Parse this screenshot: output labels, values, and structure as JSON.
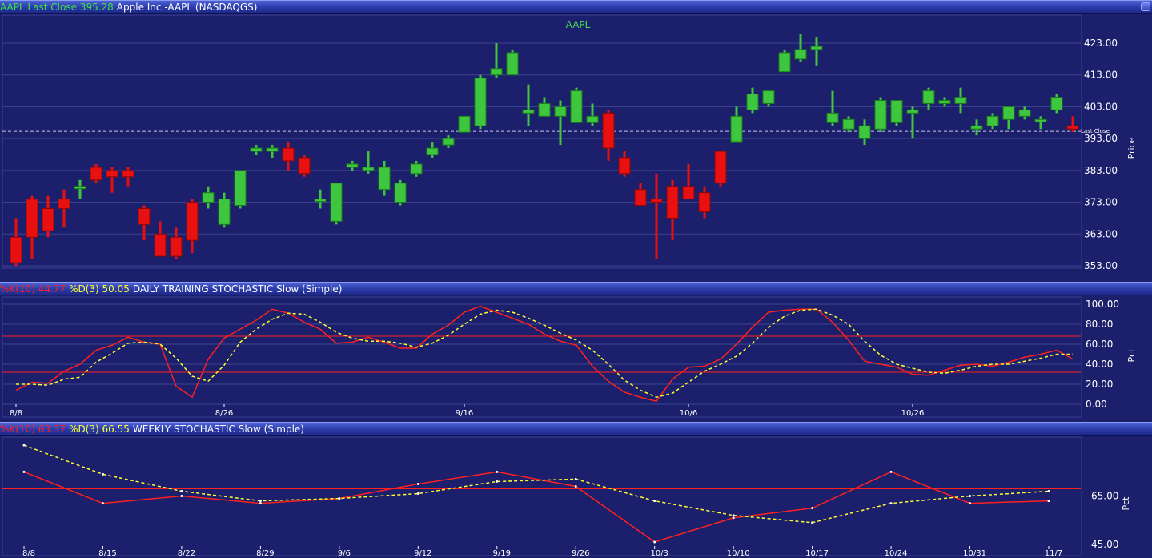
{
  "price_header": {
    "last_close_label": "AAPL.Last Close 395.28",
    "security": "Apple Inc.-AAPL (NASDAQGS)"
  },
  "daily_header": {
    "k_label": "%K(10) 44.77",
    "d_label": "%D(3) 50.05",
    "title": "DAILY TRAINING STOCHASTIC Slow (Simple)"
  },
  "weekly_header": {
    "k_label": "%K(10) 63.37",
    "d_label": "%D(3) 66.55",
    "title": "WEEKLY STOCHASTIC Slow (Simple)"
  },
  "colors": {
    "background": "#1c1f6b",
    "up": "#3ec63e",
    "down": "#e81010",
    "k_line": "#ff2020",
    "d_line": "#ffff30",
    "grid": "#3d4490"
  },
  "chart_data": [
    {
      "type": "candlestick",
      "title": "AAPL",
      "ylabel": "Price",
      "ylim": [
        353,
        423
      ],
      "yticks": [
        "423.00",
        "413.00",
        "403.00",
        "393.00",
        "383.00",
        "373.00",
        "363.00",
        "353.00"
      ],
      "last_close": 395.28,
      "last_close_label": "Last Close",
      "candles": [
        {
          "o": 362,
          "h": 368,
          "l": 353,
          "c": 354
        },
        {
          "o": 374,
          "h": 375,
          "l": 355,
          "c": 362
        },
        {
          "o": 371,
          "h": 375,
          "l": 362,
          "c": 364
        },
        {
          "o": 374,
          "h": 377,
          "l": 365,
          "c": 371
        },
        {
          "o": 378,
          "h": 380,
          "l": 374,
          "c": 378
        },
        {
          "o": 384,
          "h": 385,
          "l": 379,
          "c": 380
        },
        {
          "o": 383,
          "h": 384,
          "l": 376,
          "c": 381
        },
        {
          "o": 383,
          "h": 384,
          "l": 378,
          "c": 381
        },
        {
          "o": 371,
          "h": 372,
          "l": 361,
          "c": 366
        },
        {
          "o": 363,
          "h": 367,
          "l": 356,
          "c": 356
        },
        {
          "o": 362,
          "h": 365,
          "l": 355,
          "c": 356
        },
        {
          "o": 373,
          "h": 374,
          "l": 357,
          "c": 361
        },
        {
          "o": 373,
          "h": 378,
          "l": 371,
          "c": 376
        },
        {
          "o": 366,
          "h": 376,
          "l": 365,
          "c": 374
        },
        {
          "o": 372,
          "h": 383,
          "l": 371,
          "c": 383
        },
        {
          "o": 389,
          "h": 391,
          "l": 388,
          "c": 390
        },
        {
          "o": 389,
          "h": 391,
          "l": 387,
          "c": 390
        },
        {
          "o": 390,
          "h": 392,
          "l": 383,
          "c": 386
        },
        {
          "o": 387,
          "h": 388,
          "l": 381,
          "c": 382
        },
        {
          "o": 374,
          "h": 377,
          "l": 371,
          "c": 374
        },
        {
          "o": 367,
          "h": 379,
          "l": 366,
          "c": 379
        },
        {
          "o": 384,
          "h": 386,
          "l": 383,
          "c": 385
        },
        {
          "o": 383,
          "h": 389,
          "l": 382,
          "c": 384
        },
        {
          "o": 377,
          "h": 386,
          "l": 375,
          "c": 384
        },
        {
          "o": 373,
          "h": 380,
          "l": 372,
          "c": 379
        },
        {
          "o": 382,
          "h": 386,
          "l": 381,
          "c": 385
        },
        {
          "o": 388,
          "h": 392,
          "l": 387,
          "c": 390
        },
        {
          "o": 391,
          "h": 394,
          "l": 390,
          "c": 393
        },
        {
          "o": 395,
          "h": 400,
          "l": 395,
          "c": 400
        },
        {
          "o": 397,
          "h": 413,
          "l": 396,
          "c": 412
        },
        {
          "o": 413,
          "h": 423,
          "l": 412,
          "c": 415
        },
        {
          "o": 413,
          "h": 421,
          "l": 413,
          "c": 420
        },
        {
          "o": 401,
          "h": 410,
          "l": 397,
          "c": 402
        },
        {
          "o": 400,
          "h": 406,
          "l": 400,
          "c": 404
        },
        {
          "o": 400,
          "h": 405,
          "l": 391,
          "c": 403
        },
        {
          "o": 398,
          "h": 409,
          "l": 398,
          "c": 408
        },
        {
          "o": 398,
          "h": 404,
          "l": 397,
          "c": 400
        },
        {
          "o": 401,
          "h": 402,
          "l": 386,
          "c": 390
        },
        {
          "o": 387,
          "h": 389,
          "l": 381,
          "c": 382
        },
        {
          "o": 377,
          "h": 379,
          "l": 373,
          "c": 372
        },
        {
          "o": 374,
          "h": 382,
          "l": 355,
          "c": 373
        },
        {
          "o": 378,
          "h": 380,
          "l": 361,
          "c": 368
        },
        {
          "o": 378,
          "h": 385,
          "l": 374,
          "c": 374
        },
        {
          "o": 376,
          "h": 378,
          "l": 368,
          "c": 370
        },
        {
          "o": 389,
          "h": 389,
          "l": 378,
          "c": 379
        },
        {
          "o": 392,
          "h": 403,
          "l": 392,
          "c": 400
        },
        {
          "o": 402,
          "h": 409,
          "l": 401,
          "c": 407
        },
        {
          "o": 404,
          "h": 408,
          "l": 403,
          "c": 408
        },
        {
          "o": 414,
          "h": 421,
          "l": 414,
          "c": 420
        },
        {
          "o": 418,
          "h": 426,
          "l": 417,
          "c": 421
        },
        {
          "o": 421,
          "h": 425,
          "l": 416,
          "c": 422
        },
        {
          "o": 398,
          "h": 408,
          "l": 397,
          "c": 401
        },
        {
          "o": 396,
          "h": 400,
          "l": 395,
          "c": 399
        },
        {
          "o": 393,
          "h": 399,
          "l": 391,
          "c": 397
        },
        {
          "o": 396,
          "h": 406,
          "l": 395,
          "c": 405
        },
        {
          "o": 398,
          "h": 405,
          "l": 397,
          "c": 405
        },
        {
          "o": 401,
          "h": 403,
          "l": 393,
          "c": 402
        },
        {
          "o": 404,
          "h": 409,
          "l": 402,
          "c": 408
        },
        {
          "o": 404,
          "h": 406,
          "l": 403,
          "c": 405
        },
        {
          "o": 404,
          "h": 409,
          "l": 401,
          "c": 406
        },
        {
          "o": 396,
          "h": 399,
          "l": 394,
          "c": 397
        },
        {
          "o": 397,
          "h": 401,
          "l": 396,
          "c": 400
        },
        {
          "o": 399,
          "h": 403,
          "l": 396,
          "c": 403
        },
        {
          "o": 400,
          "h": 403,
          "l": 399,
          "c": 402
        },
        {
          "o": 399,
          "h": 400,
          "l": 396,
          "c": 399
        },
        {
          "o": 402,
          "h": 407,
          "l": 401,
          "c": 406
        },
        {
          "o": 397,
          "h": 400,
          "l": 395,
          "c": 396
        }
      ]
    },
    {
      "type": "line",
      "title": "DAILY TRAINING STOCHASTIC Slow (Simple)",
      "ylabel": "Pct",
      "ylim": [
        0,
        100
      ],
      "yticks": [
        "100.00",
        "80.00",
        "60.00",
        "40.00",
        "20.00",
        "0.00"
      ],
      "reference_lines": [
        32,
        68
      ],
      "xtick_labels": [
        {
          "label": "8/8",
          "index": 0
        },
        {
          "label": "8/26",
          "index": 13
        },
        {
          "label": "9/16",
          "index": 28
        },
        {
          "label": "10/6",
          "index": 42
        },
        {
          "label": "10/26",
          "index": 56
        }
      ],
      "series": [
        {
          "name": "%K(10)",
          "values": [
            14,
            22,
            21,
            33,
            40,
            54,
            59,
            67,
            62,
            60,
            18,
            7,
            45,
            66,
            75,
            84,
            95,
            91,
            82,
            75,
            61,
            62,
            67,
            62,
            56,
            56,
            70,
            79,
            92,
            98,
            92,
            86,
            80,
            70,
            63,
            59,
            38,
            23,
            12,
            7,
            3,
            25,
            37,
            38,
            45,
            60,
            77,
            92,
            94,
            95,
            95,
            82,
            64,
            43,
            40,
            37,
            30,
            29,
            34,
            39,
            40,
            38,
            42,
            47,
            50,
            54,
            45
          ]
        },
        {
          "name": "%D(3)",
          "values": [
            20,
            20,
            19,
            25,
            27,
            42,
            51,
            61,
            62,
            60,
            46,
            28,
            23,
            39,
            62,
            75,
            85,
            91,
            90,
            82,
            72,
            66,
            63,
            63,
            61,
            57,
            61,
            69,
            80,
            90,
            94,
            92,
            86,
            79,
            71,
            64,
            54,
            40,
            24,
            14,
            7,
            11,
            22,
            33,
            40,
            48,
            61,
            77,
            88,
            94,
            95,
            89,
            80,
            63,
            49,
            40,
            36,
            32,
            31,
            34,
            38,
            40,
            40,
            43,
            46,
            50,
            50
          ]
        }
      ]
    },
    {
      "type": "line",
      "title": "WEEKLY STOCHASTIC Slow (Simple)",
      "ylabel": "Pct",
      "ylim": [
        45,
        90
      ],
      "yticks": [
        "65.00",
        "45.00"
      ],
      "reference_lines": [
        68
      ],
      "categories": [
        "8/8",
        "8/15",
        "8/22",
        "8/29",
        "9/6",
        "9/12",
        "9/19",
        "9/26",
        "10/3",
        "10/10",
        "10/17",
        "10/24",
        "10/31",
        "11/7"
      ],
      "series": [
        {
          "name": "%K(10)",
          "values": [
            75,
            62,
            65,
            62,
            64,
            70,
            75,
            69,
            46,
            56,
            60,
            75,
            62,
            63
          ]
        },
        {
          "name": "%D(3)",
          "values": [
            86,
            74,
            67,
            63,
            64,
            66,
            71,
            72,
            63,
            57,
            54,
            62,
            65,
            67
          ]
        }
      ]
    }
  ]
}
